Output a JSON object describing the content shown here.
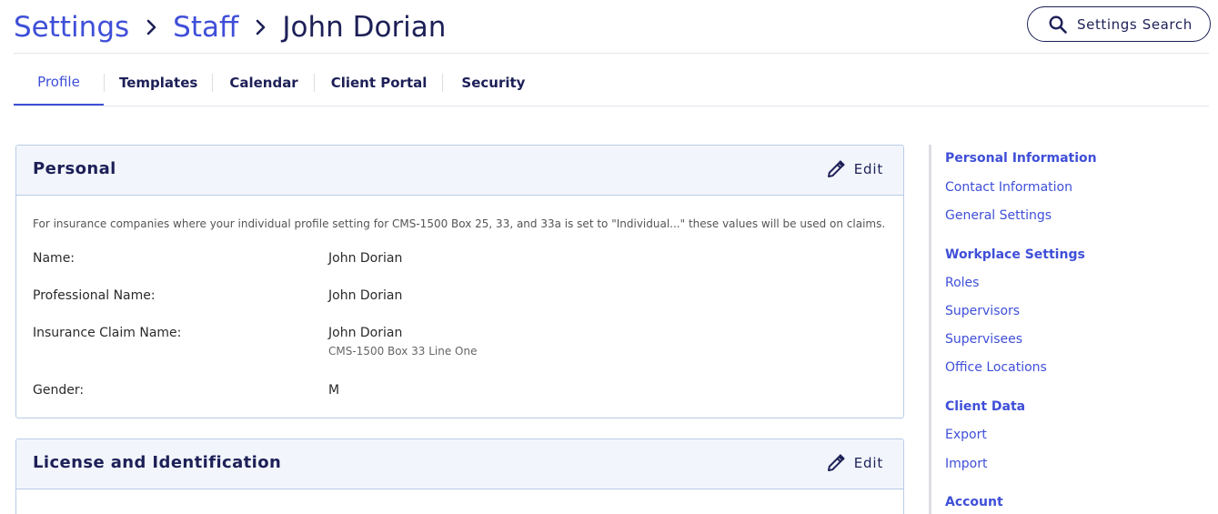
{
  "breadcrumb": {
    "items": [
      "Settings",
      "Staff"
    ],
    "current": "John Dorian"
  },
  "search": {
    "label": "Settings Search"
  },
  "tabs": [
    {
      "label": "Profile",
      "active": true
    },
    {
      "label": "Templates"
    },
    {
      "label": "Calendar"
    },
    {
      "label": "Client Portal"
    },
    {
      "label": "Security"
    }
  ],
  "personal": {
    "title": "Personal",
    "edit_label": "Edit",
    "note": "For insurance companies where your individual profile setting for CMS-1500 Box 25, 33, and 33a is set to \"Individual...\" these values will be used on claims.",
    "fields": [
      {
        "label": "Name:",
        "value": "John Dorian"
      },
      {
        "label": "Professional Name:",
        "value": "John Dorian"
      },
      {
        "label": "Insurance Claim Name:",
        "value": "John Dorian",
        "sub": "CMS-1500 Box 33 Line One"
      },
      {
        "label": "Gender:",
        "value": "M"
      }
    ]
  },
  "license": {
    "title": "License and Identification",
    "edit_label": "Edit"
  },
  "sidebar": {
    "sections": [
      {
        "heading": "Personal Information",
        "items": [
          "Contact Information",
          "General Settings"
        ]
      },
      {
        "heading": "Workplace Settings",
        "items": [
          "Roles",
          "Supervisors",
          "Supervisees",
          "Office Locations"
        ]
      },
      {
        "heading": "Client Data",
        "items": [
          "Export",
          "Import"
        ]
      },
      {
        "heading": "Account",
        "items": []
      }
    ]
  },
  "colors": {
    "accent": "#3f4fd8",
    "navy": "#1d2057",
    "card_border": "#b9cbe6",
    "card_header_bg": "#f2f6fc"
  },
  "icons": [
    "search-icon",
    "chevron-right-icon",
    "pencil-icon"
  ]
}
